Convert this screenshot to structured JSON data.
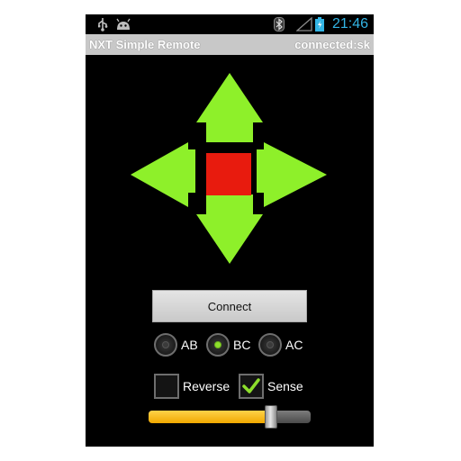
{
  "status_bar": {
    "time": "21:46",
    "icons": [
      "usb-icon",
      "android-debug-icon",
      "bluetooth-icon",
      "signal-icon",
      "battery-icon"
    ]
  },
  "title_bar": {
    "app_title": "NXT Simple Remote",
    "connection_status": "connected:sk"
  },
  "controls": {
    "dpad": [
      "arrow-up-icon",
      "arrow-down-icon",
      "arrow-left-icon",
      "arrow-right-icon",
      "stop-button"
    ],
    "connect_label": "Connect",
    "motors": {
      "options": [
        {
          "label": "AB",
          "selected": false
        },
        {
          "label": "BC",
          "selected": true
        },
        {
          "label": "AC",
          "selected": false
        }
      ]
    },
    "reverse": {
      "label": "Reverse",
      "checked": false
    },
    "sense": {
      "label": "Sense",
      "checked": true
    },
    "power_slider": {
      "value": 0.78
    }
  },
  "colors": {
    "arrow": "#8ef02a",
    "stop": "#e81b0e",
    "accent": "#33b5e5",
    "slider_fill": "#f5b800"
  }
}
